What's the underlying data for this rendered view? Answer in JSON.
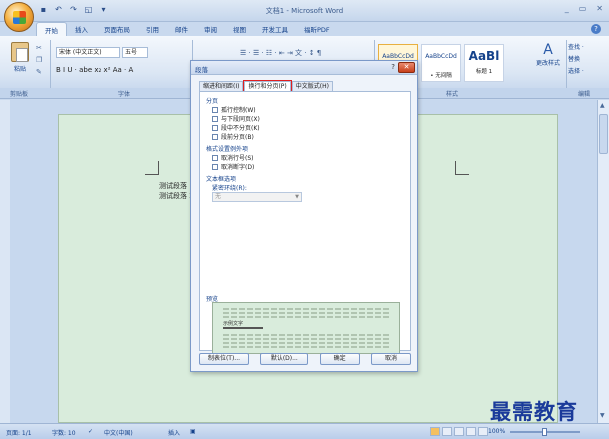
{
  "window": {
    "title": "文档1 - Microsoft Word",
    "controls": [
      "_",
      "▭",
      "✕"
    ]
  },
  "tabs": [
    "开始",
    "插入",
    "页面布局",
    "引用",
    "邮件",
    "审阅",
    "视图",
    "开发工具",
    "福昕PDF"
  ],
  "ribbon": {
    "paste_label": "粘贴",
    "font_name": "宋体 (中文正文)",
    "font_size": "五号",
    "font_tools": "B  I  U · abe  x₂  x²  Aa · A",
    "para_tools_1": "☰ · ☰ · ☷ · ⇤ ⇥ 文 · ↕ ¶",
    "para_tools_2": "≡ ≡ ≡ ≡ ≡ · ☰ · ▦",
    "styles": [
      {
        "sample": "AaBbCcDd",
        "name": "正文"
      },
      {
        "sample": "AaBbCcDd",
        "name": "• 无间隔"
      },
      {
        "sample": "AaBl",
        "name": "标题 1"
      }
    ],
    "change_styles_label": "更改样式",
    "edit_find": "查找 ·",
    "edit_replace": "替换",
    "edit_select": "选择 ·",
    "group_labels": {
      "clipboard": "剪贴板",
      "font": "字体",
      "paragraph": "段落",
      "styles": "样式",
      "editing": "编辑"
    }
  },
  "document": {
    "lines": [
      "测试段落 1",
      "测试段落 2"
    ]
  },
  "dialog": {
    "title": "段落",
    "tabs": [
      "缩进和间距(I)",
      "换行和分页(P)",
      "中文版式(H)"
    ],
    "section_pagination": "分页",
    "pagination": [
      "孤行控制(W)",
      "与下段同页(X)",
      "段中不分页(K)",
      "段前分页(B)"
    ],
    "section_format_exceptions": "格式设置例外项",
    "format_exceptions": [
      "取消行号(S)",
      "取消断字(D)"
    ],
    "section_textbox": "文本框选项",
    "tight_wrap_label": "紧密环绕(R):",
    "tight_wrap_value": "无",
    "preview_label": "预览",
    "preview_text": "示例文字",
    "buttons": {
      "tabs": "制表位(T)...",
      "default": "默认(D)...",
      "ok": "确定",
      "cancel": "取消"
    }
  },
  "statusbar": {
    "page": "页面: 1/1",
    "words": "字数: 10",
    "language": "中文(中国)",
    "mode": "插入",
    "zoom": "100%"
  },
  "watermark": "最需教育",
  "colors": {
    "ribbon_blue": "#dbe6f4",
    "page_green": "#d9ecdc",
    "active_tab_highlight": "#e02020"
  }
}
